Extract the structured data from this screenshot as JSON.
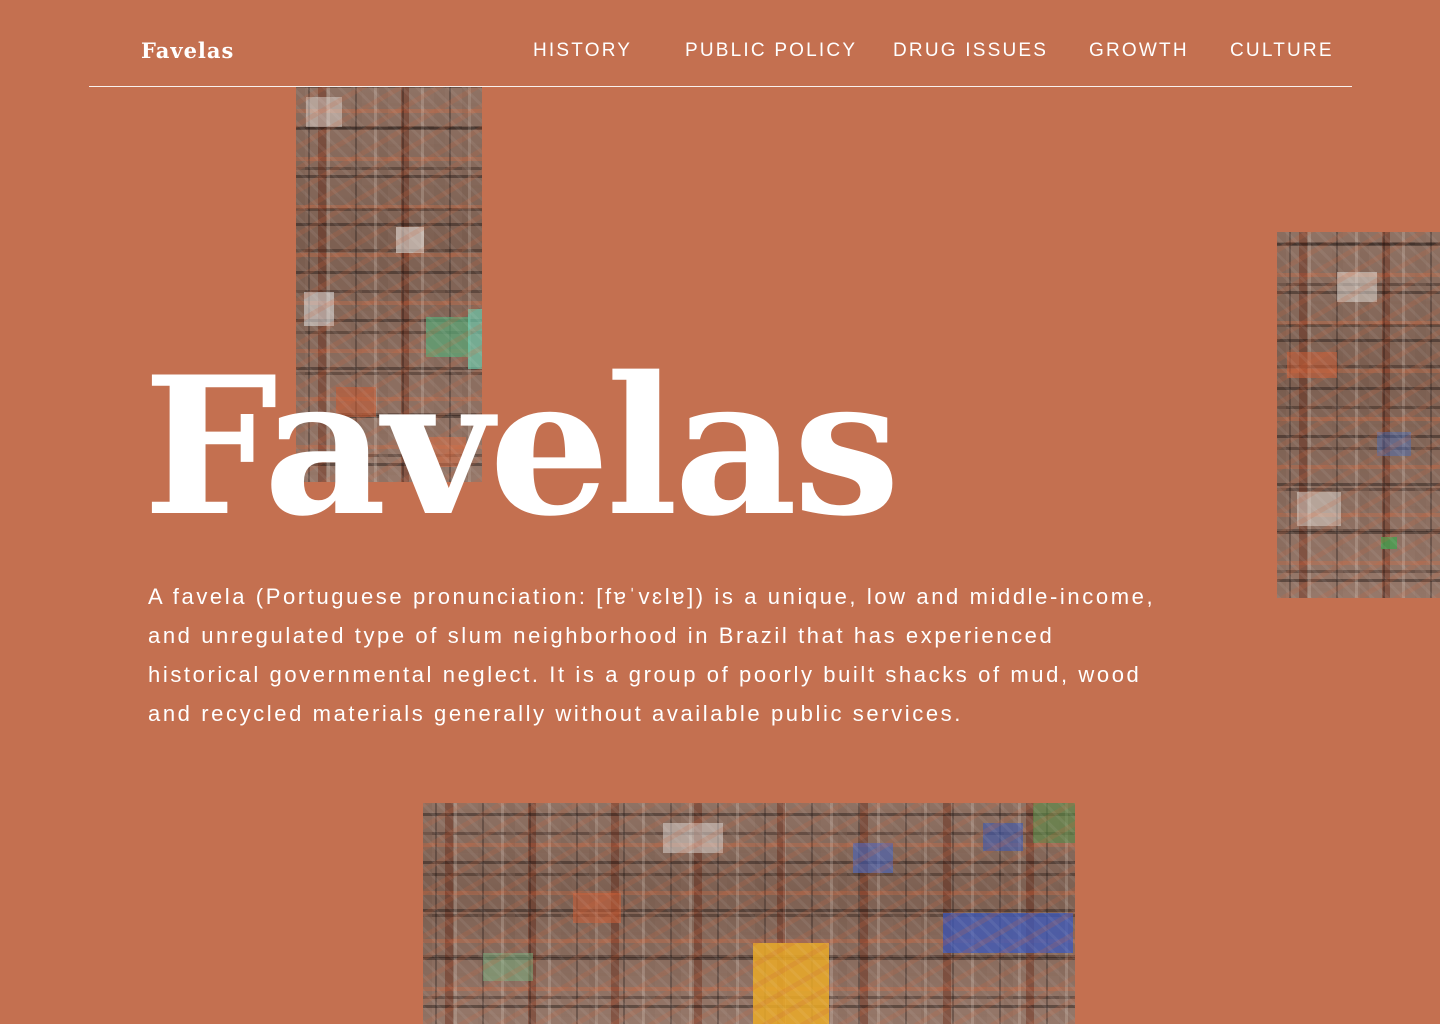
{
  "header": {
    "brand": "Favelas",
    "nav": [
      {
        "label": "HISTORY"
      },
      {
        "label": "PUBLIC POLICY"
      },
      {
        "label": "DRUG ISSUES"
      },
      {
        "label": "GROWTH"
      },
      {
        "label": "CULTURE"
      }
    ]
  },
  "hero": {
    "title": "Favelas",
    "intro": "A favela (Portuguese pronunciation: [fɐˈvɛlɐ]) is a unique, low and middle-income, and unregulated type of slum neighborhood in Brazil that has experienced historical governmental neglect. It is a group of poorly built shacks of mud, wood and recycled materials generally without available public services."
  },
  "images": [
    {
      "name": "favela-hillside-photo-top",
      "icon": "photo"
    },
    {
      "name": "favela-hillside-photo-right",
      "icon": "photo"
    },
    {
      "name": "favela-hillside-photo-bottom",
      "icon": "photo"
    }
  ],
  "colors": {
    "background": "#c47050",
    "text": "#ffffff",
    "divider": "#ffffff"
  }
}
